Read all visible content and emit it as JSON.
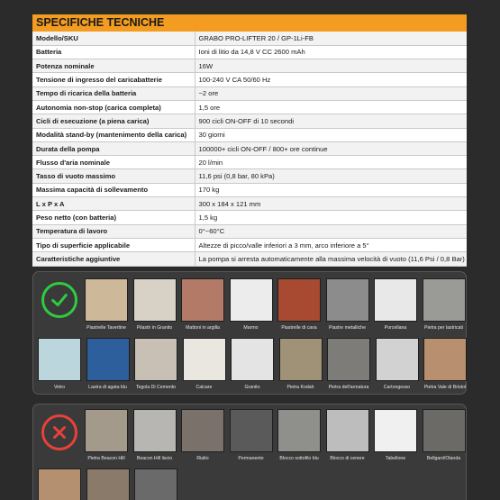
{
  "spec": {
    "title": "SPECIFICHE TECNICHE",
    "rows": [
      {
        "label": "Modello/SKU",
        "value": "GRABO PRO-LIFTER 20 / GP-1Li-FB"
      },
      {
        "label": "Batteria",
        "value": "Ioni di litio da 14,8 V CC 2600 mAh"
      },
      {
        "label": "Potenza nominale",
        "value": "16W"
      },
      {
        "label": "Tensione di ingresso del caricabatterie",
        "value": "100-240 V CA 50/60 Hz"
      },
      {
        "label": "Tempo di ricarica della batteria",
        "value": "~2 ore"
      },
      {
        "label": "Autonomia non-stop (carica completa)",
        "value": "1,5 ore"
      },
      {
        "label": "Cicli di esecuzione (a piena carica)",
        "value": "900 cicli ON-OFF di 10 secondi"
      },
      {
        "label": "Modalità stand-by (mantenimento della carica)",
        "value": "30 giorni"
      },
      {
        "label": "Durata della pompa",
        "value": "100000+ cicli ON-OFF / 800+ ore continue"
      },
      {
        "label": "Flusso d'aria nominale",
        "value": "20 l/min"
      },
      {
        "label": "Tasso di vuoto massimo",
        "value": "11,6 psi (0,8 bar, 80 kPa)"
      },
      {
        "label": "Massima capacità di sollevamento",
        "value": "170 kg"
      },
      {
        "label": "L x P x A",
        "value": "300 x 184 x 121 mm"
      },
      {
        "label": "Peso netto (con batteria)",
        "value": "1,5 kg"
      },
      {
        "label": "Temperatura di lavoro",
        "value": "0°~60°C"
      },
      {
        "label": "Tipo di superficie applicabile",
        "value": "Altezze di picco/valle inferiori a 3 mm, arco inferiore a 5°"
      },
      {
        "label": "Caratteristiche aggiuntive",
        "value": "La pompa si arresta automaticamente alla massima velocità di vuoto (11,6 Psi / 0,8 Bar)"
      }
    ]
  },
  "suitable": {
    "icon": "check-circle-icon",
    "color": "#2ecc40",
    "items": [
      {
        "label": "Piastrelle Tavertine",
        "color": "#cdb89a"
      },
      {
        "label": "Pilastri in Granito",
        "color": "#d8d2c6"
      },
      {
        "label": "Mattoni in argilla",
        "color": "#b47a68"
      },
      {
        "label": "Marmo",
        "color": "#ececec"
      },
      {
        "label": "Piastrelle di cava",
        "color": "#a84a32"
      },
      {
        "label": "Piastre metalliche",
        "color": "#8c8c8c"
      },
      {
        "label": "Porcellana",
        "color": "#e8e8e8"
      },
      {
        "label": "Pietra per lastricati",
        "color": "#9a9a96"
      },
      {
        "label": "Vetro",
        "color": "#bcd6dd"
      },
      {
        "label": "Lastra di agata blu",
        "color": "#2d5f9c"
      },
      {
        "label": "Tegola Di Cemento",
        "color": "#c8c0b4"
      },
      {
        "label": "Calcare",
        "color": "#eae6e0"
      },
      {
        "label": "Granito",
        "color": "#e4e4e4"
      },
      {
        "label": "Pietra Kodah",
        "color": "#a09276"
      },
      {
        "label": "Pietra dell'armatura",
        "color": "#7d7c78"
      },
      {
        "label": "Cartongesso",
        "color": "#d2d2d2"
      },
      {
        "label": "Pietra Vale di Bristol",
        "color": "#b89070"
      }
    ]
  },
  "unsuitable": {
    "icon": "x-circle-icon",
    "color": "#e8413a",
    "items": [
      {
        "label": "Pietra Beacon Hill",
        "color": "#a39a8c"
      },
      {
        "label": "Beacon Hill liscio",
        "color": "#b8b6b2"
      },
      {
        "label": "Rialto",
        "color": "#7a716a"
      },
      {
        "label": "Permanente",
        "color": "#5a5a5a"
      },
      {
        "label": "Blocco sottofilo blu",
        "color": "#8f8f8c"
      },
      {
        "label": "Blocco di cenere",
        "color": "#bdbdbd"
      },
      {
        "label": "Tabellone",
        "color": "#f0f0f0"
      },
      {
        "label": "Bellgard/Olanda",
        "color": "#6c6a66"
      },
      {
        "label": "",
        "color": "#b49070"
      },
      {
        "label": "",
        "color": "#8a7a6a"
      },
      {
        "label": "",
        "color": "#6a6a6a"
      }
    ]
  }
}
